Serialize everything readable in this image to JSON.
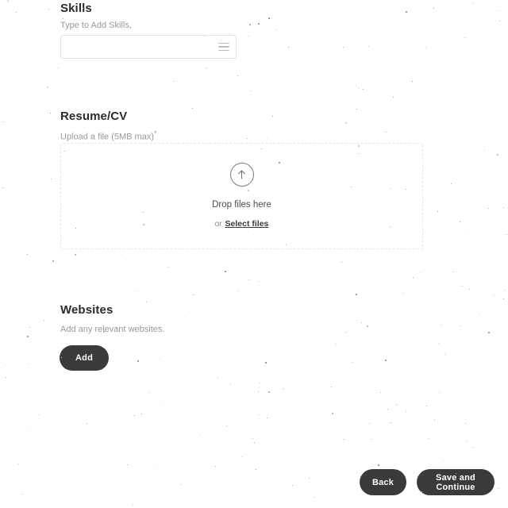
{
  "skills": {
    "title": "Skills",
    "subtitle": "Type to Add Skills,",
    "input_value": "",
    "input_placeholder": "",
    "list_icon": "list-icon"
  },
  "resume": {
    "title": "Resume/CV",
    "subtitle": "Upload a file (5MB max)",
    "required_marker": "*",
    "upload_icon": "upload-arrow-icon",
    "drop_text": "Drop files here",
    "or_label": "or",
    "select_files_label": "Select files"
  },
  "websites": {
    "title": "Websites",
    "subtitle": "Add any relevant websites.",
    "add_label": "Add"
  },
  "footer": {
    "back_label": "Back",
    "save_label": "Save and Continue"
  },
  "colors": {
    "button_dark": "#3a3a3a",
    "button_text": "#ffffff",
    "heading": "#2b2b2b",
    "muted_text": "#9a9a9a",
    "border_light": "#e3e3e3",
    "dropzone_border": "#e6e6e6",
    "page_background": "#ffffff"
  }
}
